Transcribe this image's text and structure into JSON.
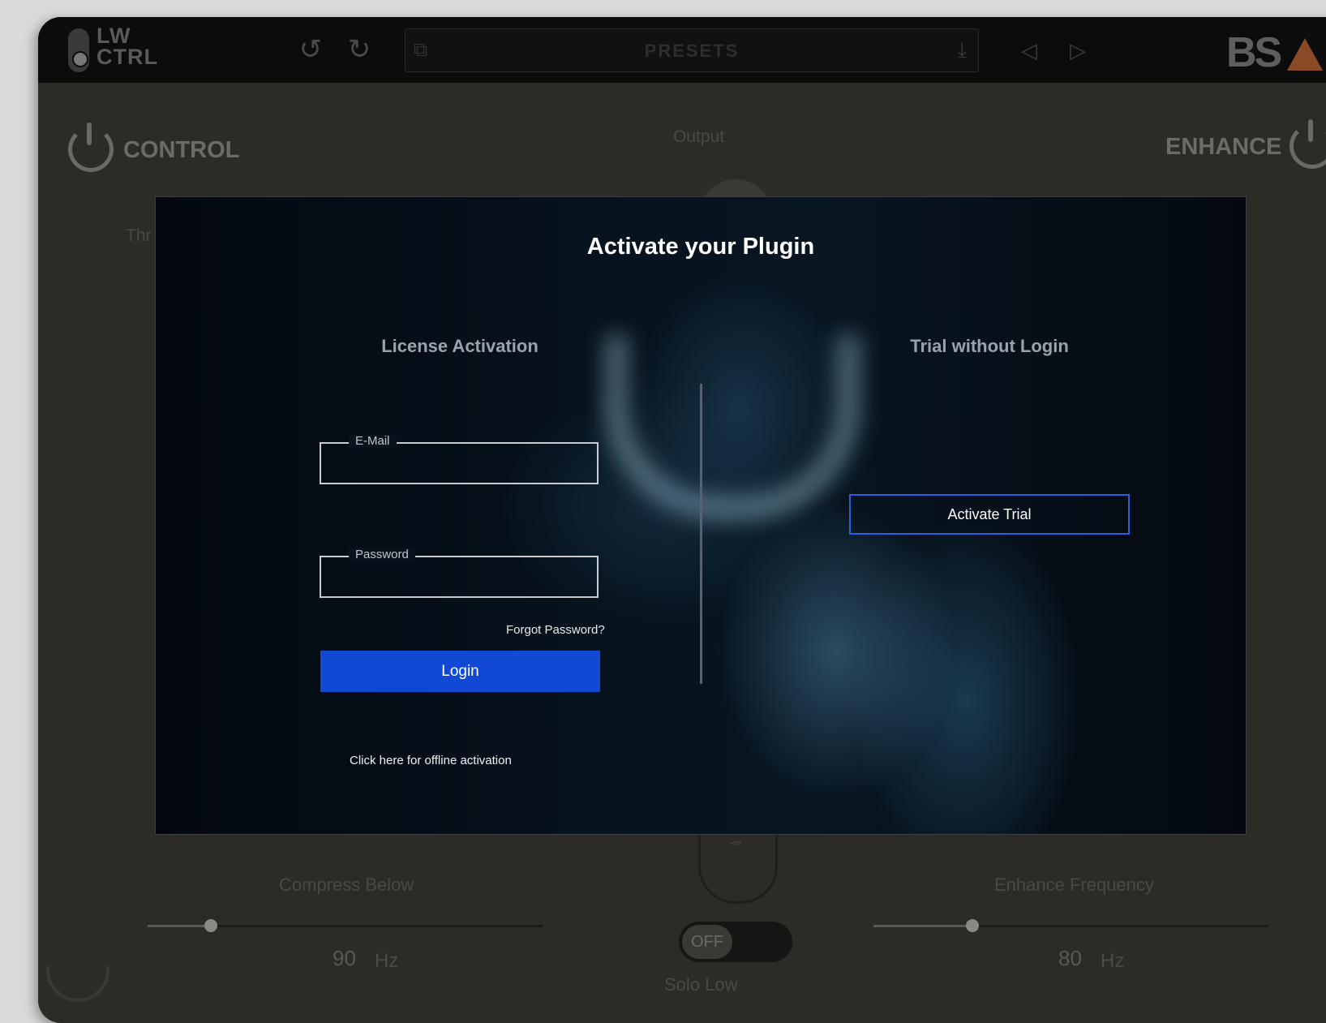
{
  "topbar": {
    "logo_line1": "LW",
    "logo_line2": "CTRL",
    "presets_label": "PRESETS",
    "brand": "BS"
  },
  "plugin": {
    "control_label": "CONTROL",
    "enhance_label": "ENHANCE",
    "output_label": "Output",
    "threshold_label_partial": "Thr",
    "compress_below_label": "Compress Below",
    "compress_below_value": "90",
    "compress_below_unit": "Hz",
    "compress_below_slider_fraction": 0.16,
    "enhance_frequency_label": "Enhance Frequency",
    "enhance_frequency_value": "80",
    "enhance_frequency_unit": "Hz",
    "enhance_frequency_slider_fraction": 0.25,
    "solo_low_label": "Solo Low",
    "solo_low_state": "OFF",
    "low_knob_value": "-∞"
  },
  "modal": {
    "title": "Activate your Plugin",
    "license_heading": "License Activation",
    "trial_heading": "Trial without Login",
    "email_legend": "E-Mail",
    "email_value": "",
    "password_legend": "Password",
    "password_value": "",
    "forgot_password": "Forgot Password?",
    "login_button": "Login",
    "offline_link": "Click here for offline activation",
    "activate_trial_button": "Activate Trial"
  },
  "colors": {
    "login_blue": "#1149d4",
    "trial_border": "#2f5de0",
    "plugin_bg": "#2c2b25",
    "topbar_bg": "#0c0c0c",
    "brand_accent": "#8a4a26"
  },
  "icons": {
    "undo": "undo-icon",
    "redo": "redo-icon",
    "external": "external-link-icon",
    "download": "download-icon",
    "prev": "prev-arrow-icon",
    "next": "next-arrow-icon",
    "power": "power-icon"
  }
}
